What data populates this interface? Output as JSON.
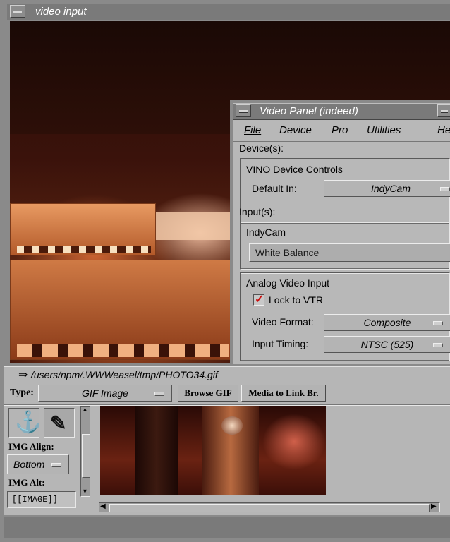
{
  "video_window": {
    "title": "video input"
  },
  "video_panel": {
    "title": "Video Panel (indeed)",
    "menu": [
      "File",
      "Device",
      "Pro",
      "Utilities",
      "He"
    ],
    "devices_label": "Device(s):",
    "vino_group": {
      "title": "VINO Device Controls",
      "default_in_label": "Default In:",
      "default_in_value": "IndyCam"
    },
    "inputs_label": "Input(s):",
    "indycam_group": {
      "title": "IndyCam",
      "white_balance_label": "White Balance"
    },
    "analog_group": {
      "title": "Analog Video Input",
      "lock_label": "Lock to VTR",
      "lock_checked": true,
      "format_label": "Video Format:",
      "format_value": "Composite",
      "timing_label": "Input Timing:",
      "timing_value": "NTSC (525)"
    }
  },
  "editor": {
    "path": "/users/npm/.WWWeasel/tmp/PHOTO34.gif",
    "type_label": "Type:",
    "type_value": "GIF Image",
    "browse_button": "Browse GIF",
    "media_button": "Media to Link Br.",
    "img_align_label": "IMG Align:",
    "img_align_value": "Bottom",
    "img_alt_label": "IMG Alt:",
    "img_alt_value": "[[IMAGE]]"
  },
  "colors": {
    "checkbox_check": "#cc1111",
    "frame": "#8a8a8a",
    "panel": "#b8b8b8"
  },
  "icons": [
    "minimize-icon",
    "anchor-icon",
    "link-tool-icon",
    "arrow-right-icon"
  ]
}
